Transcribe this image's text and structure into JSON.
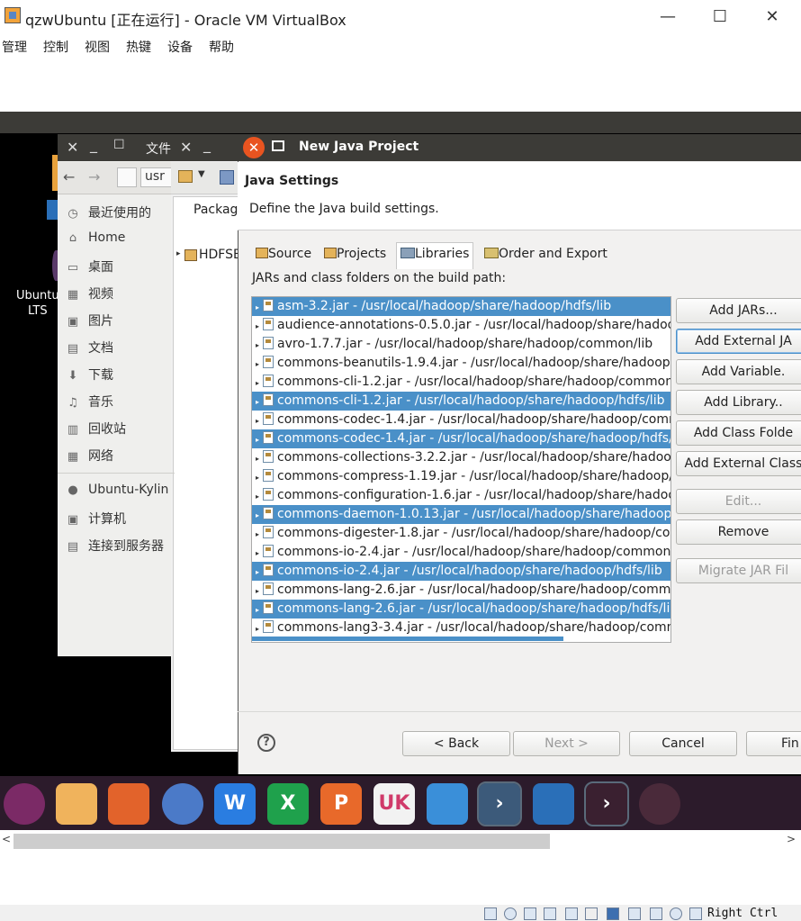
{
  "vbox": {
    "title": "qzwUbuntu [正在运行] - Oracle VM VirtualBox",
    "menu": [
      "管理",
      "控制",
      "视图",
      "热键",
      "设备",
      "帮助"
    ],
    "minimize_icon": "minimize-icon",
    "maximize_icon": "maximize-icon",
    "close_icon": "close-icon",
    "host_key": "Right Ctrl"
  },
  "desktop": {
    "icon_label": "Ubuntu\nLTS"
  },
  "file_manager": {
    "title": "文件",
    "path_fragment": "usr",
    "sidebar": [
      {
        "label": "最近使用的",
        "icon": "clock-icon"
      },
      {
        "label": "Home",
        "icon": "home-icon"
      },
      {
        "label": "桌面",
        "icon": "desktop-icon"
      },
      {
        "label": "视频",
        "icon": "video-icon"
      },
      {
        "label": "图片",
        "icon": "image-icon"
      },
      {
        "label": "文档",
        "icon": "document-icon"
      },
      {
        "label": "下载",
        "icon": "download-icon"
      },
      {
        "label": "音乐",
        "icon": "music-icon"
      },
      {
        "label": "回收站",
        "icon": "trash-icon"
      },
      {
        "label": "网络",
        "icon": "network-icon"
      },
      {
        "label": "Ubuntu-Kylin",
        "icon": "disc-icon"
      },
      {
        "label": "计算机",
        "icon": "computer-icon"
      },
      {
        "label": "连接到服务器",
        "icon": "server-icon"
      }
    ]
  },
  "eclipse": {
    "view_tab": "Packag",
    "tree_item": "HDFSE"
  },
  "dialog": {
    "title": "New Java Project",
    "section_title": "Java Settings",
    "description": "Define the Java build settings.",
    "tabs": [
      {
        "label": "Source",
        "active": false
      },
      {
        "label": "Projects",
        "active": false
      },
      {
        "label": "Libraries",
        "active": true
      },
      {
        "label": "Order and Export",
        "active": false
      }
    ],
    "list_label": "JARs and class folders on the build path:",
    "jars": [
      {
        "text": "asm-3.2.jar - /usr/local/hadoop/share/hadoop/hdfs/lib",
        "selected": true
      },
      {
        "text": "audience-annotations-0.5.0.jar - /usr/local/hadoop/share/hadoo",
        "selected": false
      },
      {
        "text": "avro-1.7.7.jar - /usr/local/hadoop/share/hadoop/common/lib",
        "selected": false
      },
      {
        "text": "commons-beanutils-1.9.4.jar - /usr/local/hadoop/share/hadoop",
        "selected": false
      },
      {
        "text": "commons-cli-1.2.jar - /usr/local/hadoop/share/hadoop/common,",
        "selected": false
      },
      {
        "text": "commons-cli-1.2.jar - /usr/local/hadoop/share/hadoop/hdfs/lib",
        "selected": true
      },
      {
        "text": "commons-codec-1.4.jar - /usr/local/hadoop/share/hadoop/comm",
        "selected": false
      },
      {
        "text": "commons-codec-1.4.jar - /usr/local/hadoop/share/hadoop/hdfs/",
        "selected": true
      },
      {
        "text": "commons-collections-3.2.2.jar - /usr/local/hadoop/share/hadoop",
        "selected": false
      },
      {
        "text": "commons-compress-1.19.jar - /usr/local/hadoop/share/hadoop/c",
        "selected": false
      },
      {
        "text": "commons-configuration-1.6.jar - /usr/local/hadoop/share/hadoo",
        "selected": false
      },
      {
        "text": "commons-daemon-1.0.13.jar - /usr/local/hadoop/share/hadoop/",
        "selected": true
      },
      {
        "text": "commons-digester-1.8.jar - /usr/local/hadoop/share/hadoop/cor",
        "selected": false
      },
      {
        "text": "commons-io-2.4.jar - /usr/local/hadoop/share/hadoop/common/",
        "selected": false
      },
      {
        "text": "commons-io-2.4.jar - /usr/local/hadoop/share/hadoop/hdfs/lib",
        "selected": true
      },
      {
        "text": "commons-lang-2.6.jar - /usr/local/hadoop/share/hadoop/comm",
        "selected": false
      },
      {
        "text": "commons-lang-2.6.jar - /usr/local/hadoop/share/hadoop/hdfs/li",
        "selected": true
      },
      {
        "text": "commons-lang3-3.4.jar - /usr/local/hadoop/share/hadoop/comm",
        "selected": false
      }
    ],
    "side_buttons": [
      {
        "label": "Add JARs...",
        "disabled": false,
        "focus": false
      },
      {
        "label": "Add External JA",
        "disabled": false,
        "focus": true
      },
      {
        "label": "Add Variable.",
        "disabled": false,
        "focus": false
      },
      {
        "label": "Add Library..",
        "disabled": false,
        "focus": false
      },
      {
        "label": "Add Class Folde",
        "disabled": false,
        "focus": false
      },
      {
        "label": "Add External Class",
        "disabled": false,
        "focus": false
      },
      {
        "label": "Edit...",
        "disabled": true,
        "focus": false
      },
      {
        "label": "Remove",
        "disabled": false,
        "focus": false
      },
      {
        "label": "Migrate JAR Fil",
        "disabled": true,
        "focus": false
      }
    ],
    "help_glyph": "?",
    "back_label": "< Back",
    "next_label": "Next >",
    "cancel_label": "Cancel",
    "finish_label": "Fin"
  },
  "dock": [
    {
      "name": "ubuntu-logo-icon",
      "color": "#7b2a66",
      "glyph": ""
    },
    {
      "name": "files-icon",
      "color": "#f0b35c",
      "glyph": ""
    },
    {
      "name": "firefox-icon",
      "color": "#e2632b",
      "glyph": ""
    },
    {
      "name": "chromium-icon",
      "color": "#4b7ac8",
      "glyph": ""
    },
    {
      "name": "wps-writer-icon",
      "color": "#2a7de1",
      "glyph": "W"
    },
    {
      "name": "wps-spreadsheet-icon",
      "color": "#1fa14c",
      "glyph": "X"
    },
    {
      "name": "wps-presentation-icon",
      "color": "#e8692a",
      "glyph": "P"
    },
    {
      "name": "software-center-icon",
      "color": "#f2f2f2",
      "glyph": "UK"
    },
    {
      "name": "kylin-assistant-icon",
      "color": "#3a8fd9",
      "glyph": ""
    },
    {
      "name": "terminal-icon",
      "color": "#3c5a7a",
      "glyph": "›"
    },
    {
      "name": "workspace-icon",
      "color": "#2a6fb8",
      "glyph": ""
    },
    {
      "name": "remote-icon",
      "color": "#3a2030",
      "glyph": "›"
    },
    {
      "name": "dvd-icon",
      "color": "#4a2a3a",
      "glyph": ""
    }
  ]
}
